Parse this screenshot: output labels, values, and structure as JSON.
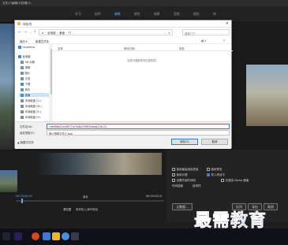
{
  "app": {
    "menus": [
      "文件(F)",
      "编辑(E)",
      "剪辑(C)",
      "序列(S)",
      "标记(M)",
      "图形(G)",
      "窗口(W)",
      "帮助(H)"
    ],
    "workspace_tabs": [
      "学习",
      "组件",
      "编辑",
      "颜色",
      "效果",
      "音频",
      "图形",
      "库"
    ],
    "active_tab_index": 2
  },
  "dialog": {
    "title": "另存为",
    "address": [
      "此电脑",
      "桌面",
      "77"
    ],
    "search_placeholder": "搜索\"77\"",
    "toolbar": {
      "organize": "组织 ▾",
      "new_folder": "新建文件夹"
    },
    "sidebar": [
      {
        "label": "OneDrive",
        "icon": "cloud-icon",
        "type": "blue"
      },
      {
        "label": "此电脑",
        "icon": "computer-icon",
        "type": "blue"
      },
      {
        "label": "3D 对象",
        "icon": "folder-icon",
        "type": "gray"
      },
      {
        "label": "视频",
        "icon": "video-icon",
        "type": "gray"
      },
      {
        "label": "图片",
        "icon": "pictures-icon",
        "type": "gray"
      },
      {
        "label": "文档",
        "icon": "documents-icon",
        "type": "gray"
      },
      {
        "label": "下载",
        "icon": "download-icon",
        "type": "blue"
      },
      {
        "label": "音乐",
        "icon": "music-icon",
        "type": "gray"
      },
      {
        "label": "桌面",
        "icon": "desktop-icon",
        "type": "blue",
        "selected": true
      },
      {
        "label": "本地磁盘 (C:)",
        "icon": "drive-icon",
        "type": "gray"
      },
      {
        "label": "本地磁盘 (D:)",
        "icon": "drive-icon",
        "type": "gray"
      },
      {
        "label": "本地磁盘 (E:)",
        "icon": "drive-icon",
        "type": "gray"
      },
      {
        "label": "本地磁盘 (F:)",
        "icon": "drive-icon",
        "type": "gray"
      }
    ],
    "columns": [
      "名称",
      "修改日期",
      "类型"
    ],
    "empty_message": "没有与搜索条件匹配的项。",
    "filename_label": "文件名(N):",
    "filename_value": "c9e0f6d02e4f9271d7a6a7f3f93faeaa23b (2)",
    "filetype_label": "保存类型(T):",
    "filetype_value": "静止图像文件(*.jpg)",
    "hide_folders": "▲ 隐藏文件夹",
    "save_button": "保存(S)",
    "cancel_button": "取消"
  },
  "export_panel": {
    "rows": [
      "使用最高渲染质量",
      "使用预览",
      "使用代理",
      "导入项目中",
      "设置开始时间码",
      "仅渲染 Alpha 通道",
      "时间插值",
      "帧采样"
    ],
    "metadata_button": "元数据...",
    "queue_button": "队列",
    "export_button": "导出",
    "cancel_button": "取消"
  },
  "timeline": {
    "timecode_left": "00;00;00;00",
    "timecode_right": "00;00;02;01",
    "fit_label": "适合",
    "source_range_label": "源范围",
    "source_range_value": "序列切入/序列切出"
  },
  "watermark": "最需教育"
}
